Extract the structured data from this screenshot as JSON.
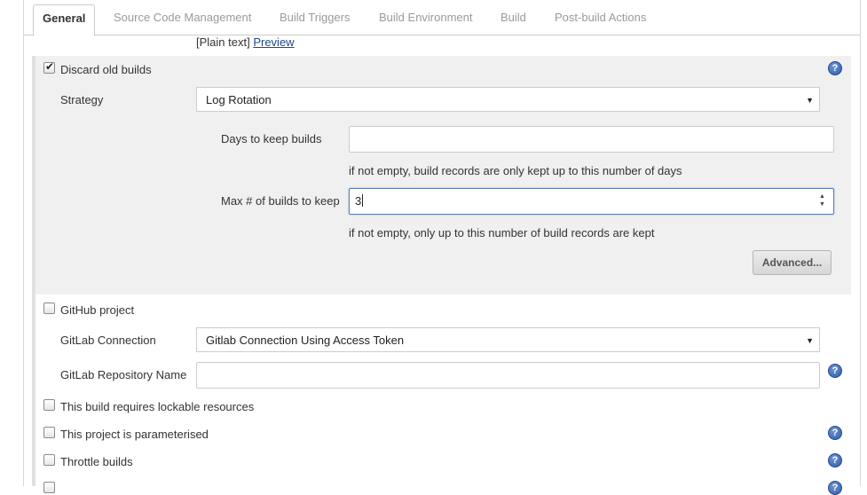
{
  "tabs": [
    {
      "label": "General",
      "active": true
    },
    {
      "label": "Source Code Management"
    },
    {
      "label": "Build Triggers"
    },
    {
      "label": "Build Environment"
    },
    {
      "label": "Build"
    },
    {
      "label": "Post-build Actions"
    }
  ],
  "description": {
    "plain_text_label": "[Plain text]",
    "preview_link": "Preview"
  },
  "discard_old_builds": {
    "label": "Discard old builds",
    "checked": true,
    "strategy_label": "Strategy",
    "strategy_value": "Log Rotation",
    "days_label": "Days to keep builds",
    "days_value": "",
    "days_hint": "if not empty, build records are only kept up to this number of days",
    "max_label": "Max # of builds to keep",
    "max_value": "3",
    "max_hint": "if not empty, only up to this number of build records are kept",
    "advanced_button": "Advanced..."
  },
  "github_project": {
    "label": "GitHub project",
    "checked": false
  },
  "gitlab": {
    "connection_label": "GitLab Connection",
    "connection_value": "Gitlab Connection Using Access Token",
    "repo_label": "GitLab Repository Name",
    "repo_value": ""
  },
  "options": [
    {
      "label": "This build requires lockable resources",
      "checked": false
    },
    {
      "label": "This project is parameterised",
      "checked": false
    },
    {
      "label": "Throttle builds",
      "checked": false
    }
  ],
  "icons": {
    "help": "help-icon",
    "dropdown": "chevron-down-icon",
    "checkmark": "checkmark-icon"
  },
  "colors": {
    "link": "#204a87",
    "help_icon": "#2d5aa8",
    "section_shade": "#f0f0f0"
  }
}
